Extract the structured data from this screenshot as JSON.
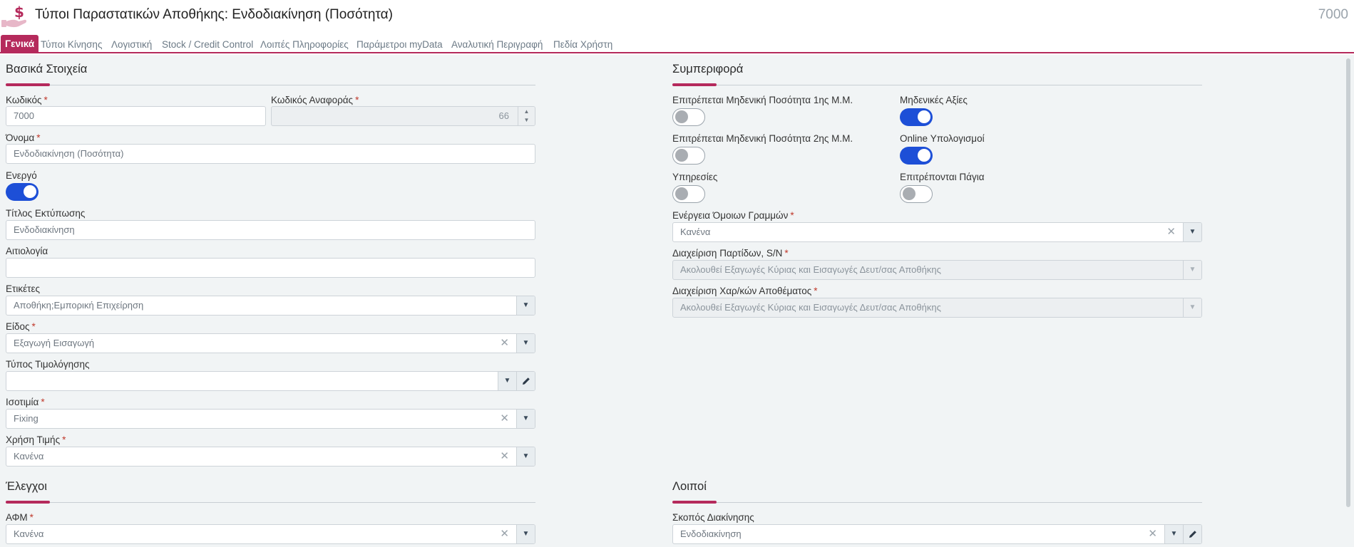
{
  "header": {
    "title": "Τύποι Παραστατικών Αποθήκης: Ενδοδιακίνηση (Ποσότητα)",
    "record_code": "7000",
    "icon": "money-hand-icon"
  },
  "tabs": [
    {
      "label": "Γενικά",
      "active": true
    },
    {
      "label": "Τύποι Κίνησης",
      "active": false
    },
    {
      "label": "Λογιστική",
      "active": false
    },
    {
      "label": "Stock / Credit Control",
      "active": false
    },
    {
      "label": "Λοιπές Πληροφορίες",
      "active": false
    },
    {
      "label": "Παράμετροι myData",
      "active": false
    },
    {
      "label": "Αναλυτική Περιγραφή",
      "active": false
    },
    {
      "label": "Πεδία Χρήστη",
      "active": false
    }
  ],
  "basic": {
    "title": "Βασικά Στοιχεία",
    "code_label": "Κωδικός",
    "code_value": "7000",
    "ref_code_label": "Κωδικός Αναφοράς",
    "ref_code_value": "66",
    "name_label": "Όνομα",
    "name_value": "Ενδοδιακίνηση (Ποσότητα)",
    "active_label": "Ενεργό",
    "active_value": true,
    "print_title_label": "Τίτλος Εκτύπωσης",
    "print_title_value": "Ενδοδιακίνηση",
    "reason_label": "Αιτιολογία",
    "reason_value": "",
    "tags_label": "Ετικέτες",
    "tags_value": "Αποθήκη;Εμπορική Επιχείρηση",
    "kind_label": "Είδος",
    "kind_value": "Εξαγωγή Εισαγωγή",
    "invoicing_type_label": "Τύπος Τιμολόγησης",
    "invoicing_type_value": "",
    "parity_label": "Ισοτιμία",
    "parity_value": "Fixing",
    "price_use_label": "Χρήση Τιμής",
    "price_use_value": "Κανένα"
  },
  "behavior": {
    "title": "Συμπεριφορά",
    "zero_qty_1_label": "Επιτρέπεται Μηδενική Ποσότητα 1ης Μ.Μ.",
    "zero_qty_1_value": false,
    "zero_values_label": "Μηδενικές Αξίες",
    "zero_values_value": true,
    "zero_qty_2_label": "Επιτρέπεται Μηδενική Ποσότητα 2ης Μ.Μ.",
    "zero_qty_2_value": false,
    "online_calc_label": "Online Υπολογισμοί",
    "online_calc_value": true,
    "services_label": "Υπηρεσίες",
    "services_value": false,
    "fixed_assets_label": "Επιτρέπονται Πάγια",
    "fixed_assets_value": false,
    "similar_lines_label": "Ενέργεια Όμοιων Γραμμών",
    "similar_lines_value": "Κανένα",
    "lots_label": "Διαχείριση Παρτίδων, S/N",
    "lots_value": "Ακολουθεί Εξαγωγές Κύριας και Εισαγωγές Δευτ/σας Αποθήκης",
    "stock_chars_label": "Διαχείριση Χαρ/κών Αποθέματος",
    "stock_chars_value": "Ακολουθεί Εξαγωγές Κύριας και Εισαγωγές Δευτ/σας Αποθήκης"
  },
  "checks": {
    "title": "Έλεγχοι",
    "vat_label": "ΑΦΜ",
    "vat_value": "Κανένα"
  },
  "others": {
    "title": "Λοιποί",
    "purpose_label": "Σκοπός Διακίνησης",
    "purpose_value": "Ενδοδιακίνηση"
  },
  "glyphs": {
    "clear": "✕",
    "dropdown": "▼",
    "spin_up": "▲",
    "spin_down": "▼"
  },
  "colors": {
    "accent": "#b52a5c",
    "toggle_on": "#1d4fd7",
    "required": "#c0392b"
  }
}
